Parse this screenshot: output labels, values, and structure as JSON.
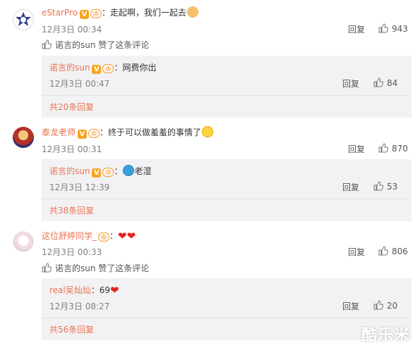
{
  "comments": [
    {
      "user": "eStarPro",
      "text": "：走起啊，我们一起去",
      "time": "12月3日 00:34",
      "reply_label": "回复",
      "likes": "943",
      "liked_by": "诺言的sun 赞了这条评论",
      "sub": {
        "user": "诺言的sun",
        "text": "：网费你出",
        "time": "12月3日 00:47",
        "reply_label": "回复",
        "likes": "84"
      },
      "more": "共20条回复"
    },
    {
      "user": "泰龙老师",
      "text": "：终于可以做羞羞的事情了",
      "time": "12月3日 00:31",
      "reply_label": "回复",
      "likes": "870",
      "sub": {
        "user": "诺言的sun",
        "text": "老湿",
        "time": "12月3日 12:39",
        "reply_label": "回复",
        "likes": "53"
      },
      "more": "共38条回复"
    },
    {
      "user": "这位舒婷同学_",
      "text": "：",
      "time": "12月3日 00:33",
      "reply_label": "回复",
      "likes": "806",
      "liked_by": "诺言的sun 赞了这条评论",
      "sub": {
        "user": "real吴灿灿",
        "text": "：69",
        "time": "12月3日 08:27",
        "reply_label": "回复",
        "likes": "20"
      },
      "more": "共56条回复"
    }
  ],
  "badges": {
    "verified": "V",
    "vip": "♔"
  },
  "watermark": "酷乐米",
  "colors": {
    "username": "#eb7350",
    "subbox_bg": "#f2f2f5",
    "heart": "#e3231b"
  }
}
